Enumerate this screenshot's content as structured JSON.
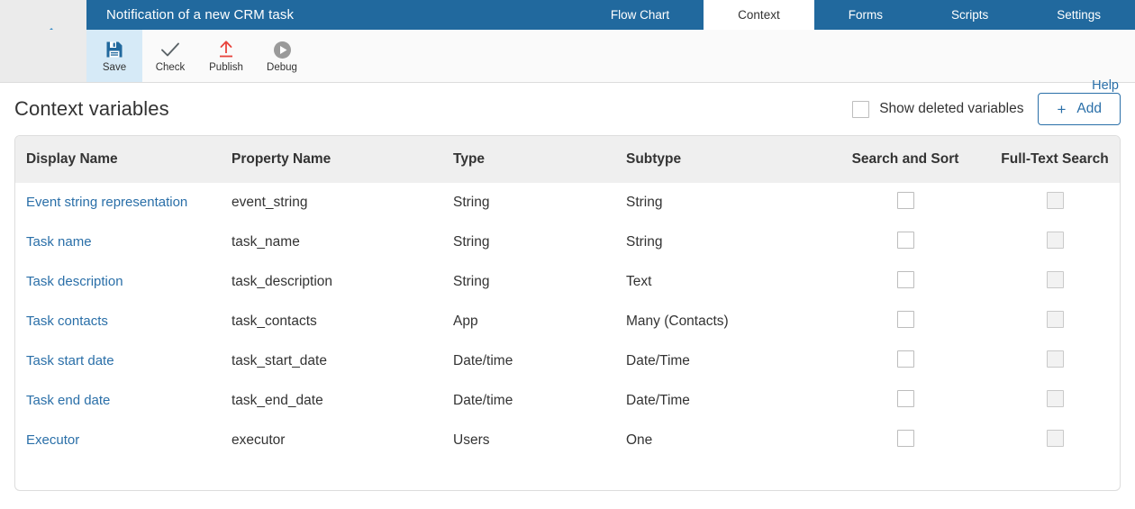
{
  "topbar": {
    "app_title": "Notification of a new CRM task",
    "back_icon": "chevron-left-icon",
    "tabs": [
      {
        "label": "Flow Chart",
        "active": false
      },
      {
        "label": "Context",
        "active": true
      },
      {
        "label": "Forms",
        "active": false
      },
      {
        "label": "Scripts",
        "active": false
      },
      {
        "label": "Settings",
        "active": false
      }
    ]
  },
  "toolbar": {
    "items": [
      {
        "label": "Save",
        "icon": "floppy-disk-icon",
        "active": true
      },
      {
        "label": "Check",
        "icon": "checkmark-icon",
        "active": false
      },
      {
        "label": "Publish",
        "icon": "upload-arrow-icon",
        "active": false
      },
      {
        "label": "Debug",
        "icon": "play-circle-icon",
        "active": false
      }
    ],
    "help_label": "Help"
  },
  "page": {
    "title": "Context variables",
    "show_deleted_label": "Show deleted variables",
    "show_deleted_checked": false,
    "add_label": "Add",
    "add_plus": "+"
  },
  "table": {
    "columns": [
      "Display Name",
      "Property Name",
      "Type",
      "Subtype",
      "Search and Sort",
      "Full-Text Search"
    ],
    "rows": [
      {
        "display_name": "Event string representation",
        "property_name": "event_string",
        "type": "String",
        "subtype": "String",
        "search_and_sort": false,
        "full_text_search": false
      },
      {
        "display_name": "Task name",
        "property_name": "task_name",
        "type": "String",
        "subtype": "String",
        "search_and_sort": false,
        "full_text_search": false
      },
      {
        "display_name": "Task description",
        "property_name": "task_description",
        "type": "String",
        "subtype": "Text",
        "search_and_sort": false,
        "full_text_search": false
      },
      {
        "display_name": "Task contacts",
        "property_name": "task_contacts",
        "type": "App",
        "subtype": "Many (Contacts)",
        "search_and_sort": false,
        "full_text_search": false
      },
      {
        "display_name": "Task start date",
        "property_name": "task_start_date",
        "type": "Date/time",
        "subtype": "Date/Time",
        "search_and_sort": false,
        "full_text_search": false
      },
      {
        "display_name": "Task end date",
        "property_name": "task_end_date",
        "type": "Date/time",
        "subtype": "Date/Time",
        "search_and_sort": false,
        "full_text_search": false
      },
      {
        "display_name": "Executor",
        "property_name": "executor",
        "type": "Users",
        "subtype": "One",
        "search_and_sort": false,
        "full_text_search": false
      }
    ]
  },
  "colors": {
    "brand_blue": "#21699e",
    "link_blue": "#2a6fa8",
    "accent_blue": "#3a8dc8",
    "publish_red": "#e8433c",
    "active_tool_bg": "#d6eaf7",
    "sidebar_gray": "#ebebeb",
    "header_row_gray": "#efefef"
  }
}
